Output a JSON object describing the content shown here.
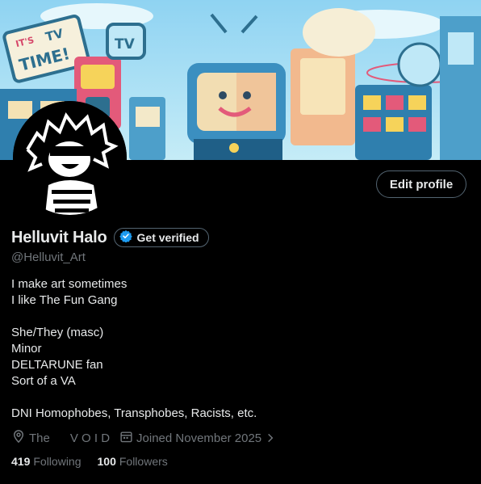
{
  "banner": {
    "sign_text_1": "IT'S",
    "sign_text_2": "TV",
    "sign_text_3": "TIME!",
    "tv_label": "TV"
  },
  "profile": {
    "display_name": "Helluvit Halo",
    "handle": "@Helluvit_Art",
    "edit_button_label": "Edit profile",
    "verify_label": "Get verified",
    "bio_lines": [
      "I make art sometimes",
      "I like The Fun Gang",
      "",
      "She/They (masc)",
      "Minor",
      "DELTARUNE fan",
      "Sort of a VA",
      "",
      "DNI Homophobes, Transphobes, Racists, etc."
    ],
    "location": "The      V O I D",
    "joined": "Joined November 2025",
    "following_count": "419",
    "following_label": "Following",
    "followers_count": "100",
    "followers_label": "Followers"
  },
  "icons": {
    "location": "location-pin-icon",
    "calendar": "calendar-icon",
    "chevron": "chevron-right-icon",
    "verified": "verified-badge-icon"
  },
  "colors": {
    "background": "#000000",
    "text_primary": "#e7e9ea",
    "text_secondary": "#71767b",
    "border": "#536471",
    "verified_blue": "#1d9bf0"
  }
}
